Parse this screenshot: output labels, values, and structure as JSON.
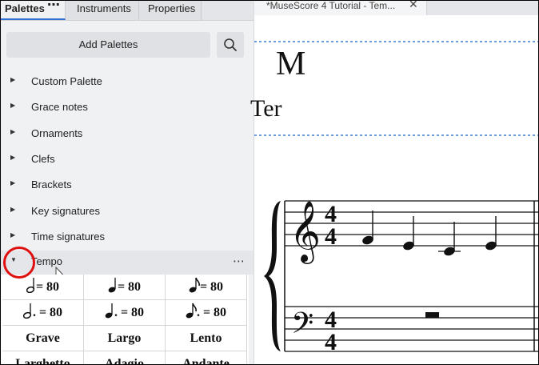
{
  "tabs": {
    "palettes": "Palettes",
    "palettes_more": "⋯",
    "instruments": "Instruments",
    "properties": "Properties"
  },
  "add_palettes_label": "Add Palettes",
  "palettes": [
    {
      "name": "Custom Palette",
      "expanded": false
    },
    {
      "name": "Grace notes",
      "expanded": false
    },
    {
      "name": "Ornaments",
      "expanded": false
    },
    {
      "name": "Clefs",
      "expanded": false
    },
    {
      "name": "Brackets",
      "expanded": false
    },
    {
      "name": "Key signatures",
      "expanded": false
    },
    {
      "name": "Time signatures",
      "expanded": false
    }
  ],
  "tempo": {
    "name": "Tempo",
    "expanded": true,
    "more": "⋯",
    "cells": [
      {
        "note": "half",
        "text": "= 80"
      },
      {
        "note": "quarter",
        "text": "= 80"
      },
      {
        "note": "eighth",
        "text": "= 80"
      },
      {
        "note": "dotted-half",
        "text": ". = 80"
      },
      {
        "note": "dotted-quarter",
        "text": ". = 80"
      },
      {
        "note": "dotted-eighth",
        "text": ". = 80"
      },
      {
        "text": "Grave"
      },
      {
        "text": "Largo"
      },
      {
        "text": "Lento"
      },
      {
        "text": "Larghetto"
      },
      {
        "text": "Adagio"
      },
      {
        "text": "Andante"
      }
    ]
  },
  "score": {
    "tab_title": "*MuseScore 4 Tutorial - Tem...",
    "close": "✕",
    "title_visible": "M",
    "subtitle_visible": "Ter",
    "time_signature": {
      "top": "4",
      "bottom": "4"
    },
    "notes": [
      "E4",
      "D4",
      "C4",
      "D4"
    ]
  },
  "colors": {
    "accent": "#2f6fd1",
    "highlight_circle": "#e01010",
    "frame_guide": "#3a7fd0"
  }
}
